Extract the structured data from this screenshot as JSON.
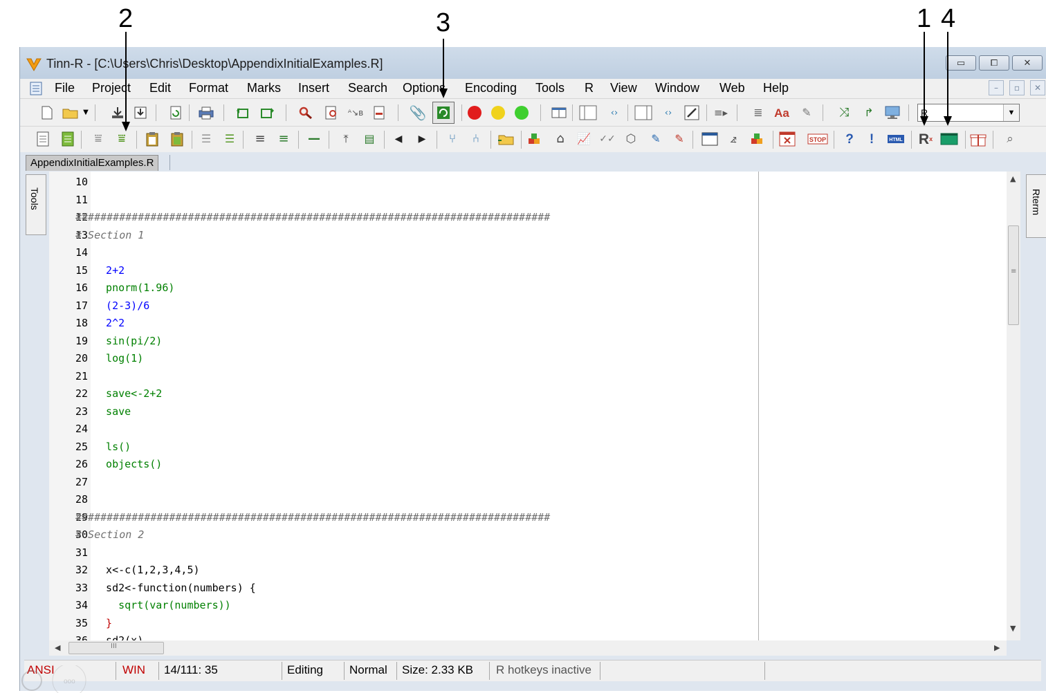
{
  "annotations": [
    "2",
    "3",
    "1",
    "4"
  ],
  "window": {
    "title": "Tinn-R - [C:\\Users\\Chris\\Desktop\\AppendixInitialExamples.R]",
    "controls": {
      "minimize": "▭",
      "maximize": "⧠",
      "close": "✕"
    }
  },
  "menu": [
    "File",
    "Project",
    "Edit",
    "Format",
    "Marks",
    "Insert",
    "Search",
    "Options",
    "Encoding",
    "Tools",
    "R",
    "View",
    "Window",
    "Web",
    "Help"
  ],
  "toolbar": {
    "language_select": "R"
  },
  "tabs": [
    "AppendixInitialExamples.R"
  ],
  "side_panels": {
    "left": "Tools",
    "right": "Rterm"
  },
  "editor": {
    "lines": [
      {
        "n": "10",
        "code": ""
      },
      {
        "n": "11",
        "code": ""
      },
      {
        "n": "12",
        "code": "############################################################################",
        "kind": "comment"
      },
      {
        "n": "13",
        "code": "# Section 1",
        "kind": "comment"
      },
      {
        "n": "14",
        "code": ""
      },
      {
        "n": "15",
        "code": "  2+2",
        "kind": "num"
      },
      {
        "n": "16",
        "code": "  pnorm(1.96)",
        "kind": "func"
      },
      {
        "n": "17",
        "code": "  (2-3)/6",
        "kind": "num"
      },
      {
        "n": "18",
        "code": "  2^2",
        "kind": "num"
      },
      {
        "n": "19",
        "code": "  sin(pi/2)",
        "kind": "func"
      },
      {
        "n": "20",
        "code": "  log(1)",
        "kind": "func"
      },
      {
        "n": "21",
        "code": ""
      },
      {
        "n": "22",
        "code": "  save<-2+2",
        "kind": "func"
      },
      {
        "n": "23",
        "code": "  save",
        "kind": "func"
      },
      {
        "n": "24",
        "code": ""
      },
      {
        "n": "25",
        "code": "  ls()",
        "kind": "func"
      },
      {
        "n": "26",
        "code": "  objects()",
        "kind": "func"
      },
      {
        "n": "27",
        "code": ""
      },
      {
        "n": "28",
        "code": ""
      },
      {
        "n": "29",
        "code": "############################################################################",
        "kind": "comment"
      },
      {
        "n": "30",
        "code": "# Section 2",
        "kind": "comment"
      },
      {
        "n": "31",
        "code": ""
      },
      {
        "n": "32",
        "code": "  x<-c(1,2,3,4,5)",
        "kind": "plain"
      },
      {
        "n": "33",
        "code": "  sd2<-function(numbers) {",
        "kind": "plain"
      },
      {
        "n": "34",
        "code": "    sqrt(var(numbers))",
        "kind": "func"
      },
      {
        "n": "35",
        "code": "  }",
        "kind": "op"
      },
      {
        "n": "36",
        "code": "  sd2(x)",
        "kind": "plain"
      }
    ]
  },
  "status": {
    "encoding": "ANSI",
    "eol": "WIN",
    "position": "14/111: 35",
    "mode": "Editing",
    "view": "Normal",
    "size": "Size: 2.33 KB",
    "hotkeys": "R hotkeys inactive"
  },
  "colors": {
    "comment": "#707070",
    "number": "#0000ff",
    "function": "#008000",
    "operator": "#c00000",
    "status_red": "#c00000"
  }
}
